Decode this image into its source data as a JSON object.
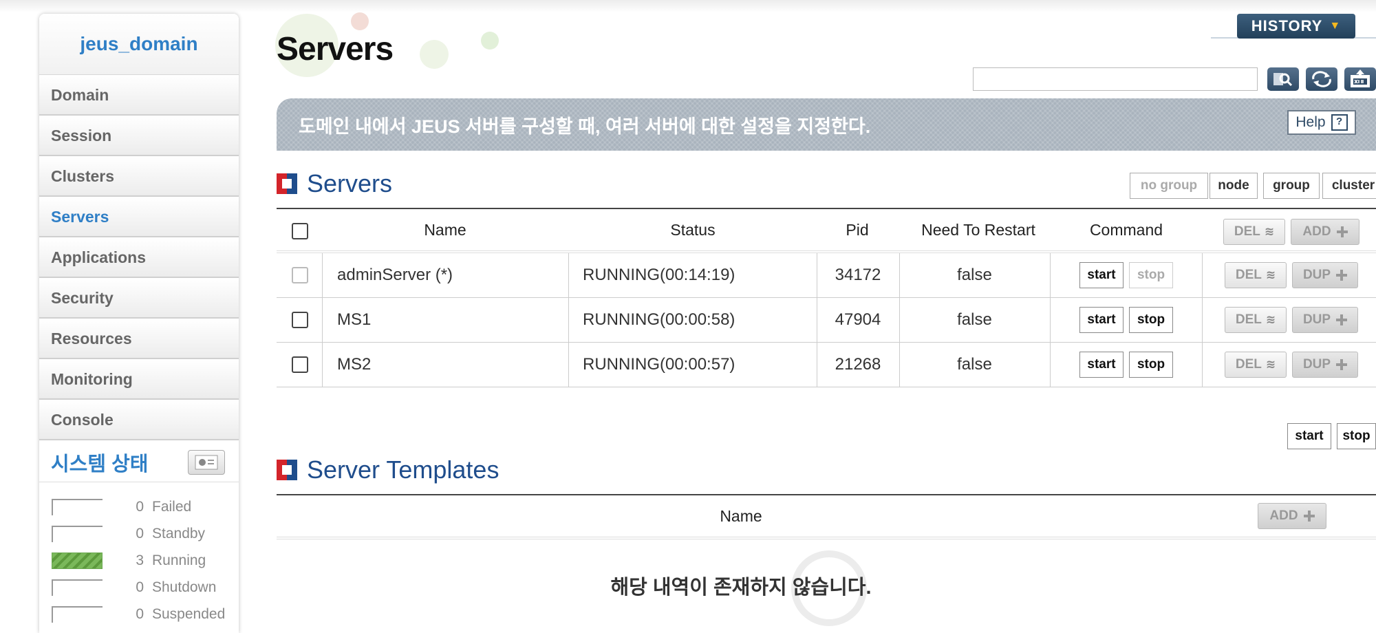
{
  "sidebar": {
    "domain": "jeus_domain",
    "nav": [
      "Domain",
      "Session",
      "Clusters",
      "Servers",
      "Applications",
      "Security",
      "Resources",
      "Monitoring",
      "Console"
    ],
    "active": "Servers",
    "system_status_title": "시스템 상태",
    "status": [
      {
        "count": "0",
        "label": "Failed"
      },
      {
        "count": "0",
        "label": "Standby"
      },
      {
        "count": "3",
        "label": "Running"
      },
      {
        "count": "0",
        "label": "Shutdown"
      },
      {
        "count": "0",
        "label": "Suspended"
      }
    ]
  },
  "header": {
    "title": "Servers",
    "history": "HISTORY",
    "search_value": "",
    "banner": "도메인 내에서 JEUS 서버를 구성할 때, 여러 서버에 대한 설정을 지정한다.",
    "help": "Help"
  },
  "servers": {
    "title": "Servers",
    "filters": [
      "no group",
      "node",
      "group",
      "cluster"
    ],
    "columns": [
      "Name",
      "Status",
      "Pid",
      "Need To Restart",
      "Command"
    ],
    "del_label": "DEL",
    "add_label": "ADD",
    "dup_label": "DUP",
    "start_label": "start",
    "stop_label": "stop",
    "rows": [
      {
        "name": "adminServer (*)",
        "status": "RUNNING(00:14:19)",
        "pid": "34172",
        "restart": "false"
      },
      {
        "name": "MS1",
        "status": "RUNNING(00:00:58)",
        "pid": "47904",
        "restart": "false"
      },
      {
        "name": "MS2",
        "status": "RUNNING(00:00:57)",
        "pid": "21268",
        "restart": "false"
      }
    ],
    "bottom_start": "start",
    "bottom_stop": "stop"
  },
  "templates": {
    "title": "Server Templates",
    "column": "Name",
    "add_label": "ADD",
    "empty": "해당 내역이 존재하지 않습니다."
  },
  "colors": {
    "accent": "#2f7fc6",
    "section": "#1f4d8c",
    "red": "#d3242a"
  }
}
